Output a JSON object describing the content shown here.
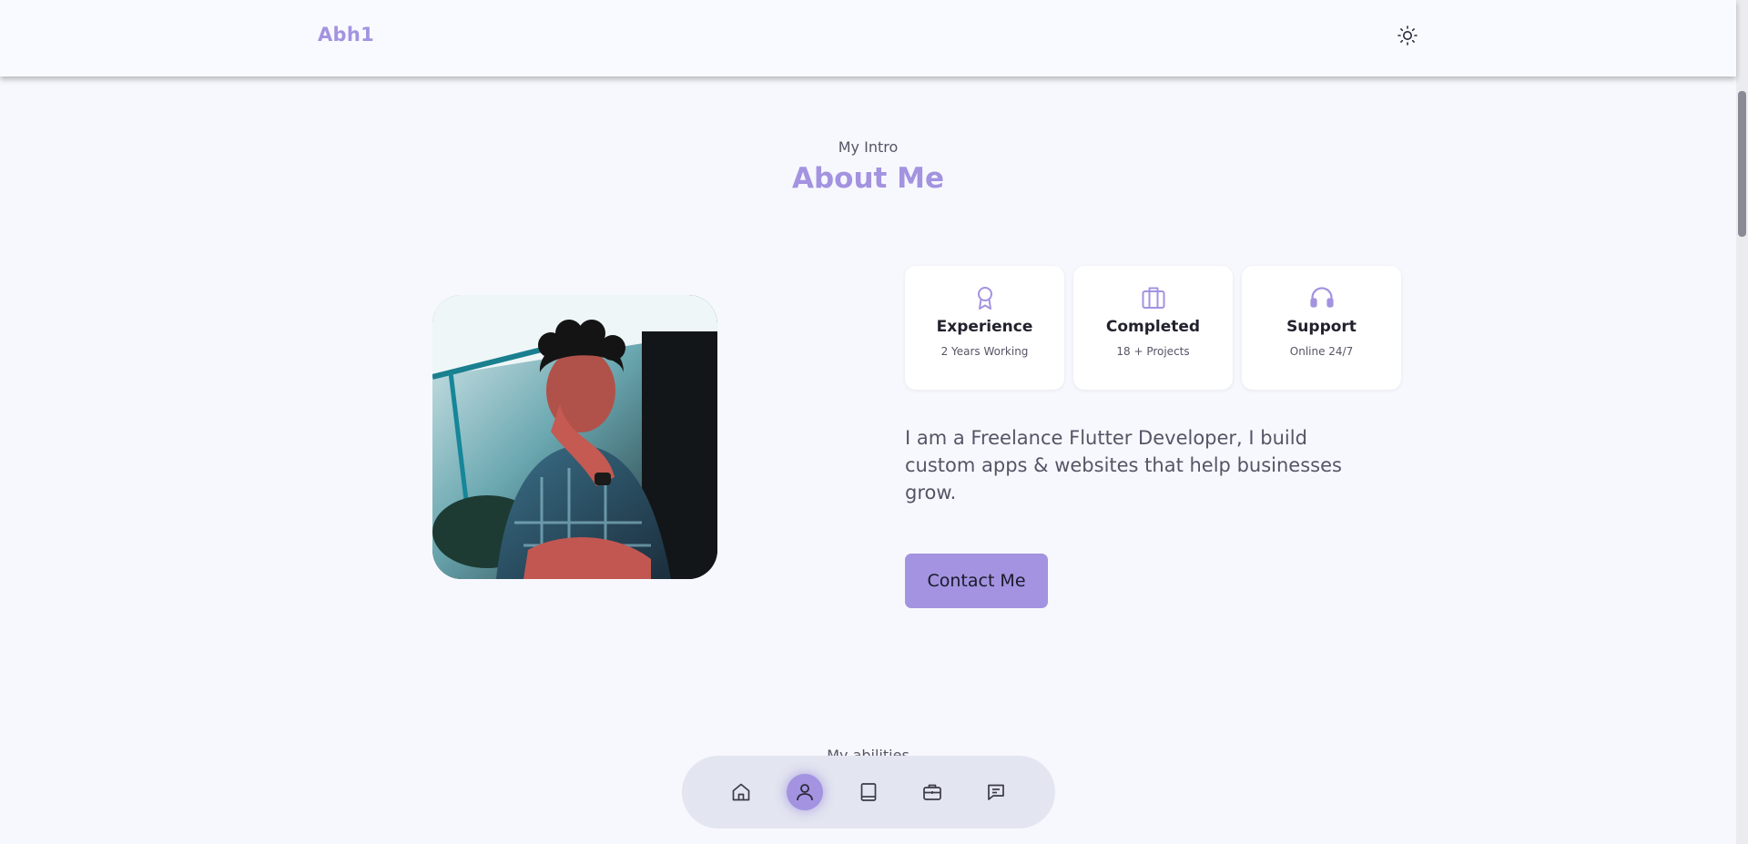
{
  "header": {
    "logo": "Abh1",
    "theme_icon": "sun-icon"
  },
  "about": {
    "subtitle": "My Intro",
    "title": "About Me",
    "cards": [
      {
        "icon": "award-icon",
        "title": "Experience",
        "subtitle": "2 Years Working"
      },
      {
        "icon": "briefcase-icon",
        "title": "Completed",
        "subtitle": "18 + Projects"
      },
      {
        "icon": "headset-icon",
        "title": "Support",
        "subtitle": "Online 24/7"
      }
    ],
    "description": "I am a Freelance Flutter Developer, I build custom apps & websites that help businesses grow.",
    "contact_label": "Contact Me"
  },
  "skills": {
    "subtitle": "My abilities"
  },
  "bottom_nav": {
    "items": [
      {
        "icon": "home-icon",
        "active": false
      },
      {
        "icon": "user-icon",
        "active": true
      },
      {
        "icon": "book-icon",
        "active": false
      },
      {
        "icon": "briefcase-icon",
        "active": false
      },
      {
        "icon": "message-icon",
        "active": false
      }
    ]
  },
  "colors": {
    "accent": "#a393e0",
    "background": "#f7f8fd",
    "card": "#ffffff",
    "nav": "#e3e6f0"
  }
}
